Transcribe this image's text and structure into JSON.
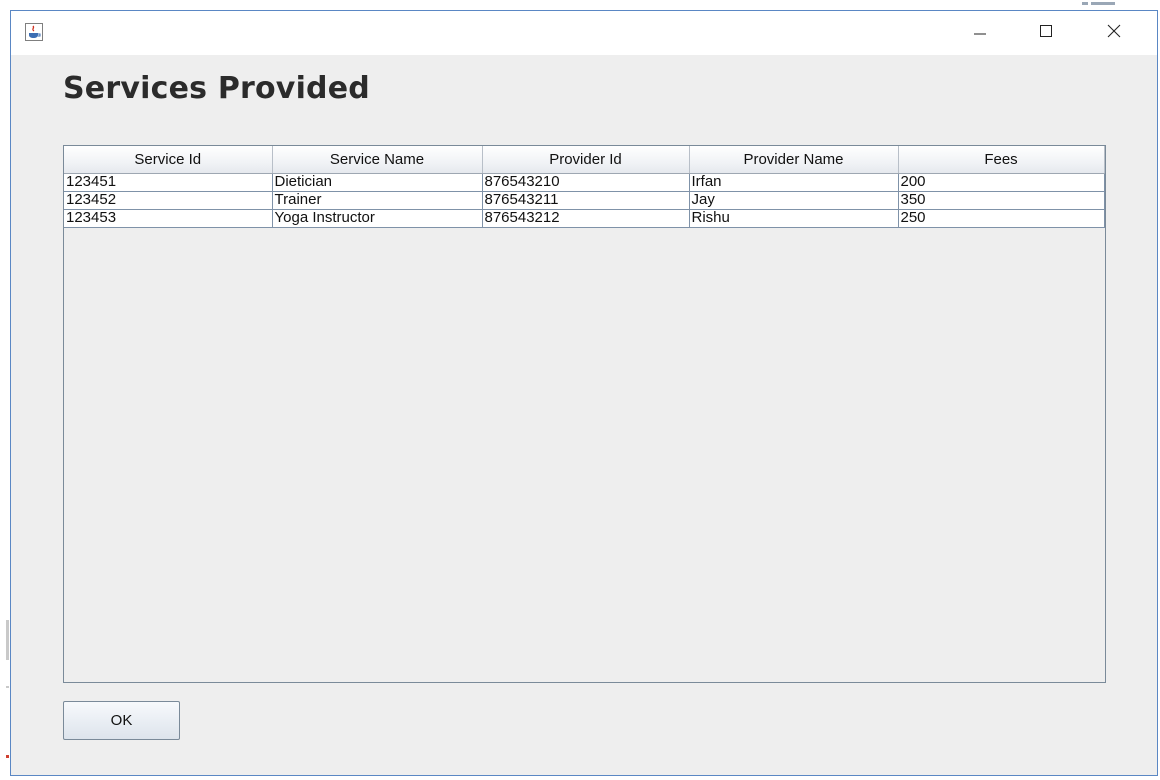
{
  "window": {
    "icon": "java-cup-icon",
    "controls": {
      "minimize": "minimize-icon",
      "maximize": "maximize-icon",
      "close": "close-icon"
    },
    "border_color": "#5a87c4"
  },
  "page": {
    "title": "Services Provided"
  },
  "table": {
    "columns": [
      "Service Id",
      "Service Name",
      "Provider Id",
      "Provider Name",
      "Fees"
    ],
    "rows": [
      [
        "123451",
        "Dietician",
        "876543210",
        "Irfan",
        "200"
      ],
      [
        "123452",
        "Trainer",
        "876543211",
        "Jay",
        "350"
      ],
      [
        "123453",
        "Yoga Instructor",
        "876543212",
        "Rishu",
        "250"
      ]
    ]
  },
  "buttons": {
    "ok_label": "OK"
  }
}
